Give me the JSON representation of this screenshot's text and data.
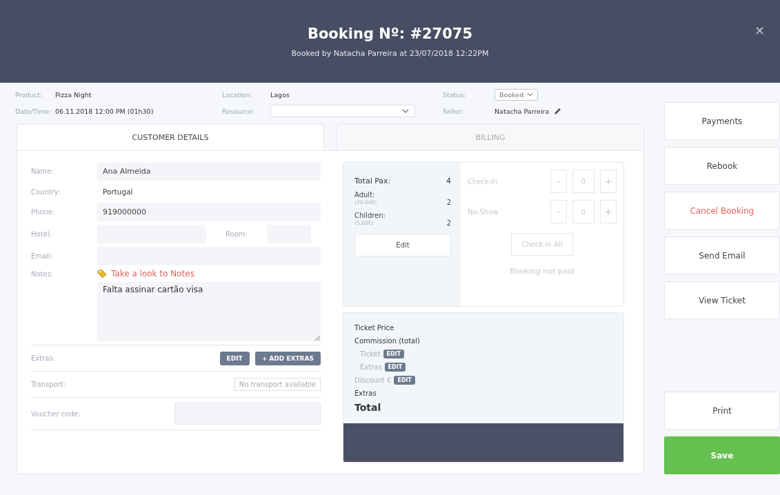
{
  "header": {
    "title": "Booking Nº: #27075",
    "subtitle": "Booked by Natacha Parreira at 23/07/2018 12:22PM",
    "close": "×"
  },
  "info": {
    "product": {
      "label": "Product:",
      "value": "Pizza Night"
    },
    "datetime": {
      "label": "Date/Time:",
      "value": "06.11.2018 12:00 PM (01h30)"
    },
    "location": {
      "label": "Location:",
      "value": "Lagos"
    },
    "resource": {
      "label": "Resource:"
    },
    "status": {
      "label": "Status:",
      "value": "Booked"
    },
    "seller": {
      "label": "Seller:",
      "value": "Natacha Parreira"
    }
  },
  "tabs": [
    {
      "label": "CUSTOMER DETAILS",
      "selected": true
    },
    {
      "label": "BILLING",
      "selected": false
    }
  ],
  "customer": {
    "fields": [
      {
        "kind": "input",
        "label": "Name:",
        "value": "Ana Almeida"
      },
      {
        "kind": "text",
        "label": "Country:",
        "value": "Portugal"
      },
      {
        "kind": "input",
        "label": "Phone:",
        "value": "919000000"
      },
      {
        "kind": "split",
        "label": "Hotel:",
        "second_label": "Room:"
      },
      {
        "kind": "input",
        "label": "Email:"
      }
    ],
    "notes": {
      "label": "Notes:",
      "alert": "Take a look to Notes",
      "value": "Falta assinar cartão visa"
    },
    "extras": {
      "label": "Extras:",
      "buttons": [
        "EDIT",
        "+ ADD EXTRAS"
      ]
    },
    "transport": {
      "label": "Transport:",
      "value": "No transport available"
    },
    "voucher": {
      "label": "Voucher code:"
    }
  },
  "pax": {
    "total_label": "Total Pax:",
    "total": "4",
    "categories": [
      {
        "name": "Adult:",
        "price": "(20.00€)",
        "count": "2"
      },
      {
        "name": "Children:",
        "price": "(5.00€)",
        "count": "2"
      }
    ],
    "edit": "Edit"
  },
  "checkin": {
    "disabled": true,
    "counters": [
      {
        "label": "Check-In",
        "minus": "-",
        "value": "0",
        "plus": "+"
      },
      {
        "label": "No-Show",
        "minus": "-",
        "value": "0",
        "plus": "+"
      }
    ],
    "all_button": "Check-in All",
    "payment_note": "Booking not paid"
  },
  "billing": [
    {
      "kind": "line",
      "label": "Ticket Price"
    },
    {
      "kind": "line",
      "label": "Commission (total)"
    },
    {
      "kind": "sub",
      "label": "Ticket",
      "button": "EDIT"
    },
    {
      "kind": "sub",
      "label": "Extras",
      "button": "EDIT"
    },
    {
      "kind": "muted",
      "label": "Discount €",
      "button": "EDIT"
    },
    {
      "kind": "line",
      "label": "Extras"
    },
    {
      "kind": "total",
      "label": "Total"
    }
  ],
  "actions": [
    {
      "kind": "normal",
      "label": "Payments"
    },
    {
      "kind": "normal",
      "label": "Rebook"
    },
    {
      "kind": "danger",
      "label": "Cancel Booking"
    },
    {
      "kind": "normal",
      "label": "Send Email"
    },
    {
      "kind": "normal",
      "label": "View Ticket"
    }
  ],
  "bottom_actions": [
    {
      "kind": "normal",
      "label": "Print"
    },
    {
      "kind": "primary",
      "label": "Save"
    }
  ]
}
